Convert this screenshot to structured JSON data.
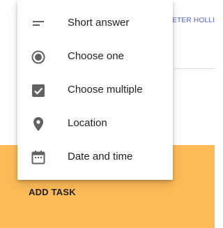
{
  "background": {
    "header_name": "PETER HOLLI",
    "accent_orange": "#FDBB57",
    "header_text_color": "#4A5FD6"
  },
  "footer": {
    "add_task_label": "ADD TASK"
  },
  "menu": {
    "items": [
      {
        "label": "Short answer",
        "icon": "short-text-icon"
      },
      {
        "label": "Choose one",
        "icon": "radio-button-checked-icon"
      },
      {
        "label": "Choose multiple",
        "icon": "checkbox-checked-icon"
      },
      {
        "label": "Location",
        "icon": "location-pin-icon"
      },
      {
        "label": "Date and time",
        "icon": "calendar-icon"
      }
    ],
    "icon_color": "#616161"
  }
}
